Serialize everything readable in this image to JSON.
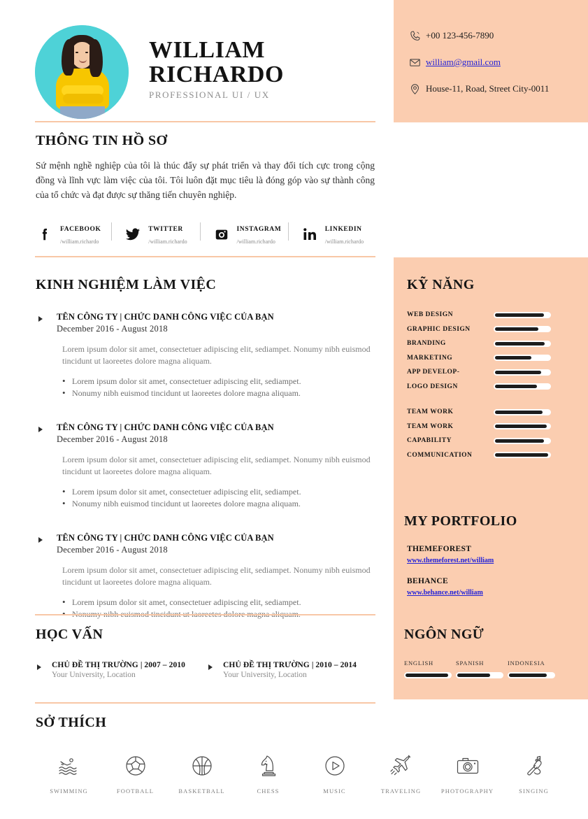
{
  "header": {
    "name_line1": "WILLIAM",
    "name_line2": "RICHARDO",
    "role": "PROFESSIONAL UI / UX",
    "avatar_icon": "profile-photo"
  },
  "contact": {
    "phone": "+00 123-456-7890",
    "email": "william@gmail.com",
    "address": "House-11, Road, Street City-0011",
    "phone_icon": "phone-icon",
    "email_icon": "envelope-icon",
    "address_icon": "map-pin-icon"
  },
  "profile": {
    "title": "THÔNG TIN HỒ SƠ",
    "body": "Sứ mệnh nghề nghiệp của tôi là thúc đẩy sự phát triển và thay đổi tích cực trong cộng đồng và lĩnh vực làm việc của tôi. Tôi luôn đặt mục tiêu là đóng góp vào sự thành công của tổ chức và đạt được sự thăng tiến chuyên nghiệp."
  },
  "social": [
    {
      "name": "FACEBOOK",
      "handle": "/william.richardo",
      "icon": "facebook-icon"
    },
    {
      "name": "TWITTER",
      "handle": "/william.richardo",
      "icon": "twitter-icon"
    },
    {
      "name": "INSTAGRAM",
      "handle": "/william.richardo",
      "icon": "instagram-icon"
    },
    {
      "name": "LINKEDIN",
      "handle": "/william.richardo",
      "icon": "linkedin-icon"
    }
  ],
  "experience": {
    "title": "KINH NGHIỆM LÀM VIỆC",
    "items": [
      {
        "title": "TÊN CÔNG TY | CHỨC DANH CÔNG VIỆC CỦA BẠN",
        "date": "December 2016 - August 2018",
        "desc": "Lorem ipsum dolor sit amet, consectetuer adipiscing elit, sediampet. Nonumy nibh euismod tincidunt ut laoreetes dolore magna aliquam.",
        "bullets": [
          "Lorem ipsum dolor sit amet, consectetuer adipiscing elit, sediampet.",
          "Nonumy nibh euismod tincidunt ut laoreetes dolore magna aliquam."
        ]
      },
      {
        "title": "TÊN CÔNG TY | CHỨC DANH CÔNG VIỆC CỦA BẠN",
        "date": "December 2016 - August 2018",
        "desc": "Lorem ipsum dolor sit amet, consectetuer adipiscing elit, sediampet. Nonumy nibh euismod tincidunt ut laoreetes dolore magna aliquam.",
        "bullets": [
          "Lorem ipsum dolor sit amet, consectetuer adipiscing elit, sediampet.",
          "Nonumy nibh euismod tincidunt ut laoreetes dolore magna aliquam."
        ]
      },
      {
        "title": "TÊN CÔNG TY | CHỨC DANH CÔNG VIỆC CỦA BẠN",
        "date": "December 2016 - August 2018",
        "desc": "Lorem ipsum dolor sit amet, consectetuer adipiscing elit, sediampet. Nonumy nibh euismod tincidunt ut laoreetes dolore magna aliquam.",
        "bullets": [
          "Lorem ipsum dolor sit amet, consectetuer adipiscing elit, sediampet.",
          "Nonumy nibh euismod tincidunt ut laoreetes dolore magna aliquam."
        ]
      }
    ]
  },
  "education": {
    "title": "HỌC VẤN",
    "items": [
      {
        "title": "CHỦ ĐỀ THỊ TRƯỜNG | 2007 – 2010",
        "sub": "Your University, Location"
      },
      {
        "title": "CHỦ ĐỀ THỊ TRƯỜNG | 2010 – 2014",
        "sub": "Your University, Location"
      }
    ]
  },
  "hobbies": {
    "title": "SỞ THÍCH",
    "items": [
      {
        "label": "SWIMMING",
        "icon": "swimming-icon"
      },
      {
        "label": "FOOTBALL",
        "icon": "football-icon"
      },
      {
        "label": "BASKETBALL",
        "icon": "basketball-icon"
      },
      {
        "label": "CHESS",
        "icon": "chess-knight-icon"
      },
      {
        "label": "MUSIC",
        "icon": "play-circle-icon"
      },
      {
        "label": "TRAVELING",
        "icon": "airplane-icon"
      },
      {
        "label": "PHOTOGRAPHY",
        "icon": "camera-icon"
      },
      {
        "label": "SINGING",
        "icon": "microphone-icon"
      }
    ]
  },
  "skills": {
    "title": "KỸ NĂNG",
    "group1": [
      {
        "name": "WEB DESIGN",
        "value": 90
      },
      {
        "name": "GRAPHIC DESIGN",
        "value": 80
      },
      {
        "name": "BRANDING",
        "value": 92
      },
      {
        "name": "MARKETING",
        "value": 68
      },
      {
        "name": "APP DEVELOP-",
        "value": 85
      },
      {
        "name": "LOGO DESIGN",
        "value": 78
      }
    ],
    "group2": [
      {
        "name": "TEAM WORK",
        "value": 88
      },
      {
        "name": "TEAM WORK",
        "value": 95
      },
      {
        "name": "CAPABILITY",
        "value": 90
      },
      {
        "name": "COMMUNICATION",
        "value": 97
      }
    ]
  },
  "portfolio": {
    "title": "MY PORTFOLIO",
    "items": [
      {
        "name": "THEMEFOREST",
        "url": "www.themeforest.net/william"
      },
      {
        "name": "BEHANCE",
        "url": "www.behance.net/william"
      }
    ]
  },
  "languages": {
    "title": "NGÔN NGỮ",
    "items": [
      {
        "name": "ENGLISH",
        "value": 95
      },
      {
        "name": "SPANISH",
        "value": 75
      },
      {
        "name": "INDONESIA",
        "value": 85
      }
    ]
  },
  "colors": {
    "peach": "#fbcdb0",
    "link": "#2323d8",
    "dark": "#1d1d1d",
    "accent_rule": "#f8c7a6"
  }
}
